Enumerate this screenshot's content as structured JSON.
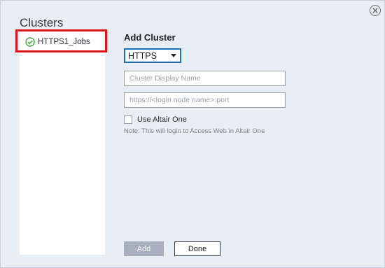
{
  "clusters_panel": {
    "title": "Clusters",
    "items": [
      {
        "label": "HTTPS1_Jobs",
        "status": "connected",
        "icon": "check-circle-icon",
        "highlighted": true
      }
    ]
  },
  "add_cluster": {
    "title": "Add Cluster",
    "protocol_select": {
      "value": "HTTPS"
    },
    "display_name_input": {
      "value": "",
      "placeholder": "Cluster Display Name"
    },
    "url_input": {
      "value": "",
      "placeholder": "https://<login node name>:port"
    },
    "altair_one_checkbox": {
      "label": "Use Altair One",
      "checked": false
    },
    "note": "Note: This will login to Access Web in Altair One",
    "add_button_label": "Add",
    "done_button_label": "Done"
  },
  "window": {
    "close_icon": "close-circle-icon"
  },
  "colors": {
    "background": "#e9eef5",
    "check_green": "#3aa83a",
    "select_border": "#1e6fb5",
    "highlight_red": "#e0141b",
    "add_button_disabled": "#a7b0bc"
  }
}
